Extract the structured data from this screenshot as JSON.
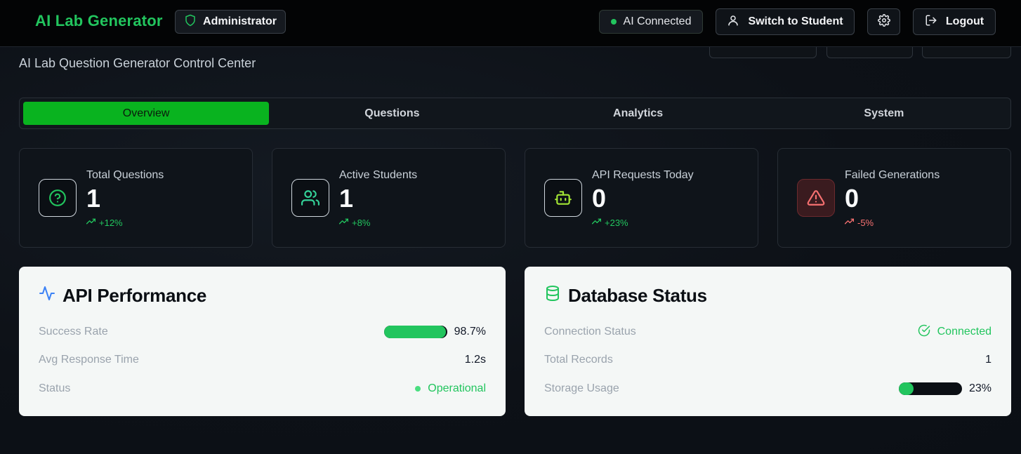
{
  "header": {
    "brand": "AI Lab Generator",
    "role": "Administrator",
    "ai_status": "AI Connected",
    "switch_label": "Switch to Student",
    "logout_label": "Logout"
  },
  "subtitle": "AI Lab Question Generator Control Center",
  "tabs": [
    {
      "label": "Overview",
      "active": true
    },
    {
      "label": "Questions",
      "active": false
    },
    {
      "label": "Analytics",
      "active": false
    },
    {
      "label": "System",
      "active": false
    }
  ],
  "stats": [
    {
      "label": "Total Questions",
      "value": "1",
      "delta": "+12%",
      "icon": "help-circle-icon"
    },
    {
      "label": "Active Students",
      "value": "1",
      "delta": "+8%",
      "icon": "users-icon"
    },
    {
      "label": "API Requests Today",
      "value": "0",
      "delta": "+23%",
      "icon": "bot-icon"
    },
    {
      "label": "Failed Generations",
      "value": "0",
      "delta": "-5%",
      "icon": "alert-triangle-icon"
    }
  ],
  "api_performance": {
    "title": "API Performance",
    "rows": [
      {
        "key": "Success Rate",
        "value": "98.7%",
        "progress": 0.987
      },
      {
        "key": "Avg Response Time",
        "value": "1.2s"
      },
      {
        "key": "Status",
        "value": "Operational"
      }
    ]
  },
  "database_status": {
    "title": "Database Status",
    "rows": [
      {
        "key": "Connection Status",
        "value": "Connected"
      },
      {
        "key": "Total Records",
        "value": "1"
      },
      {
        "key": "Storage Usage",
        "value": "23%",
        "progress": 0.23
      }
    ]
  },
  "colors": {
    "accent": "#22c55e",
    "active_tab": "#09b31f",
    "danger": "#f87171"
  }
}
